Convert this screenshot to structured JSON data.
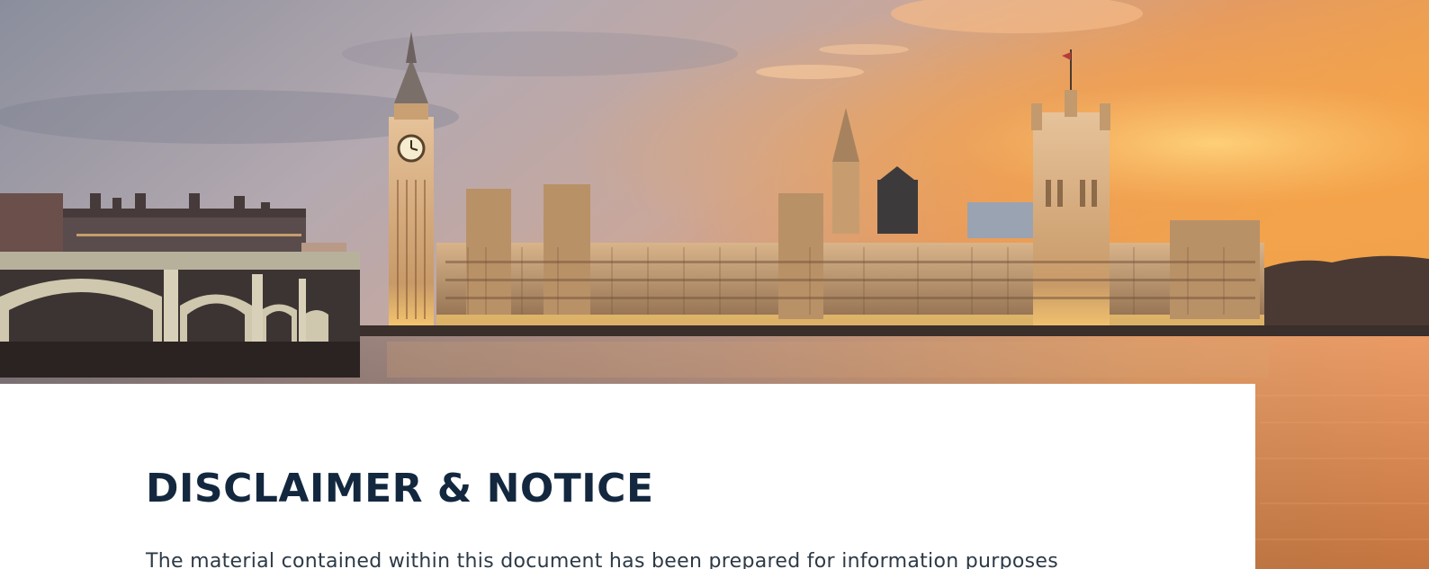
{
  "hero": {
    "scene": "westminster-skyline-photo"
  },
  "content": {
    "title": "DISCLAIMER & NOTICE",
    "intro": "The material contained within this document has been prepared for information purposes"
  },
  "colors": {
    "title": "#13283f",
    "body_text": "#2d3a46",
    "card_background": "#ffffff"
  }
}
